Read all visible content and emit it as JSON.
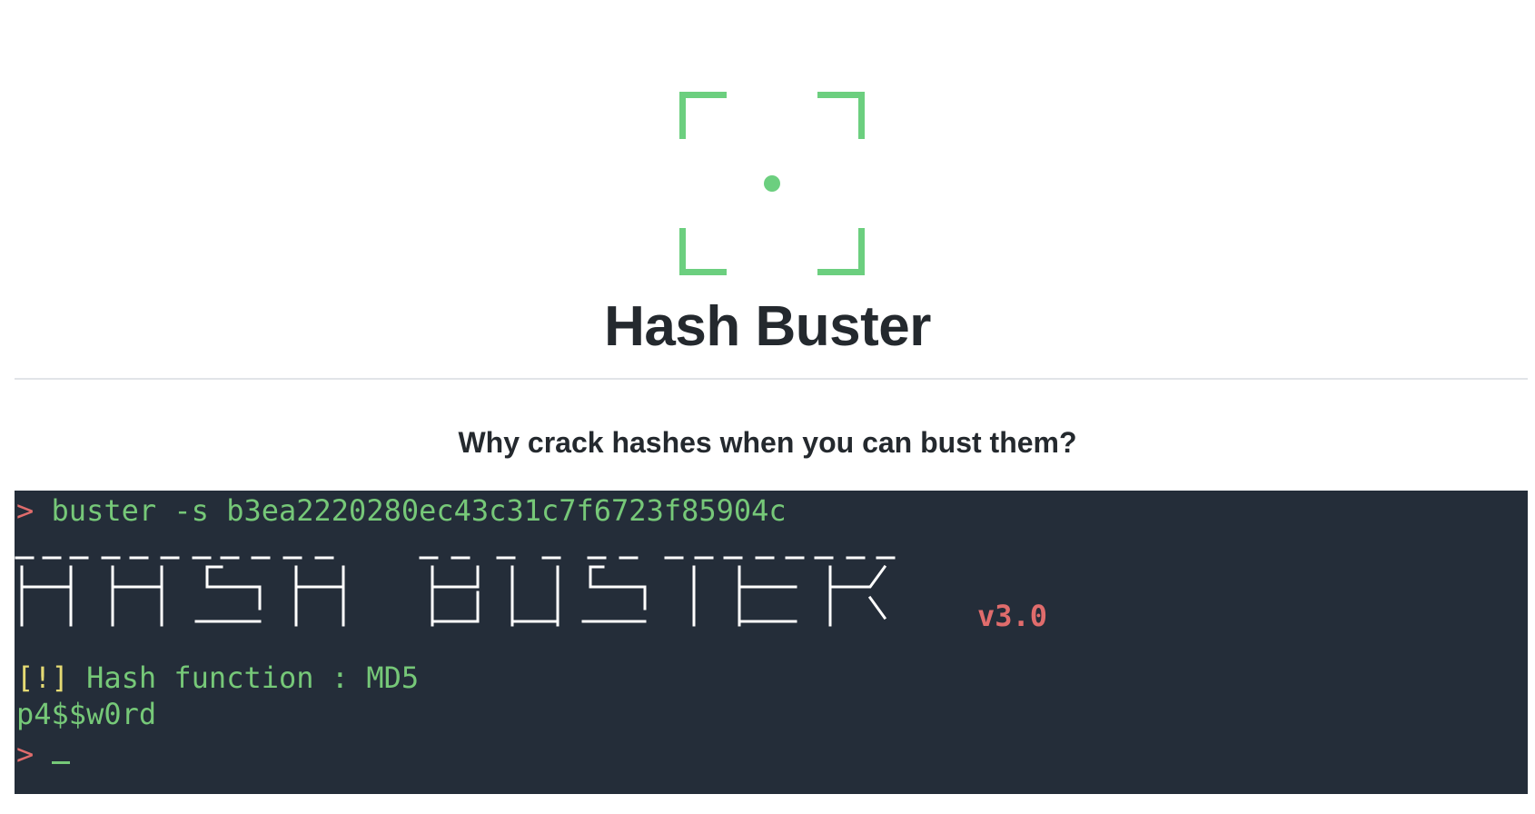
{
  "header": {
    "title": "Hash Buster",
    "tagline": "Why crack hashes when you can bust them?"
  },
  "colors": {
    "accent": "#76c878",
    "terminal_bg": "#242d39",
    "prompt": "#e06c6c",
    "warn": "#e6db74"
  },
  "terminal": {
    "prompt_symbol": ">",
    "command": "buster -s b3ea2220280ec43c31c7f6723f85904c",
    "banner_text": "HASH BUSTER",
    "version": "v3.0",
    "info_marker": "[!]",
    "info_text": "Hash function : MD5",
    "result": "p4$$w0rd",
    "final_prompt": ">"
  }
}
